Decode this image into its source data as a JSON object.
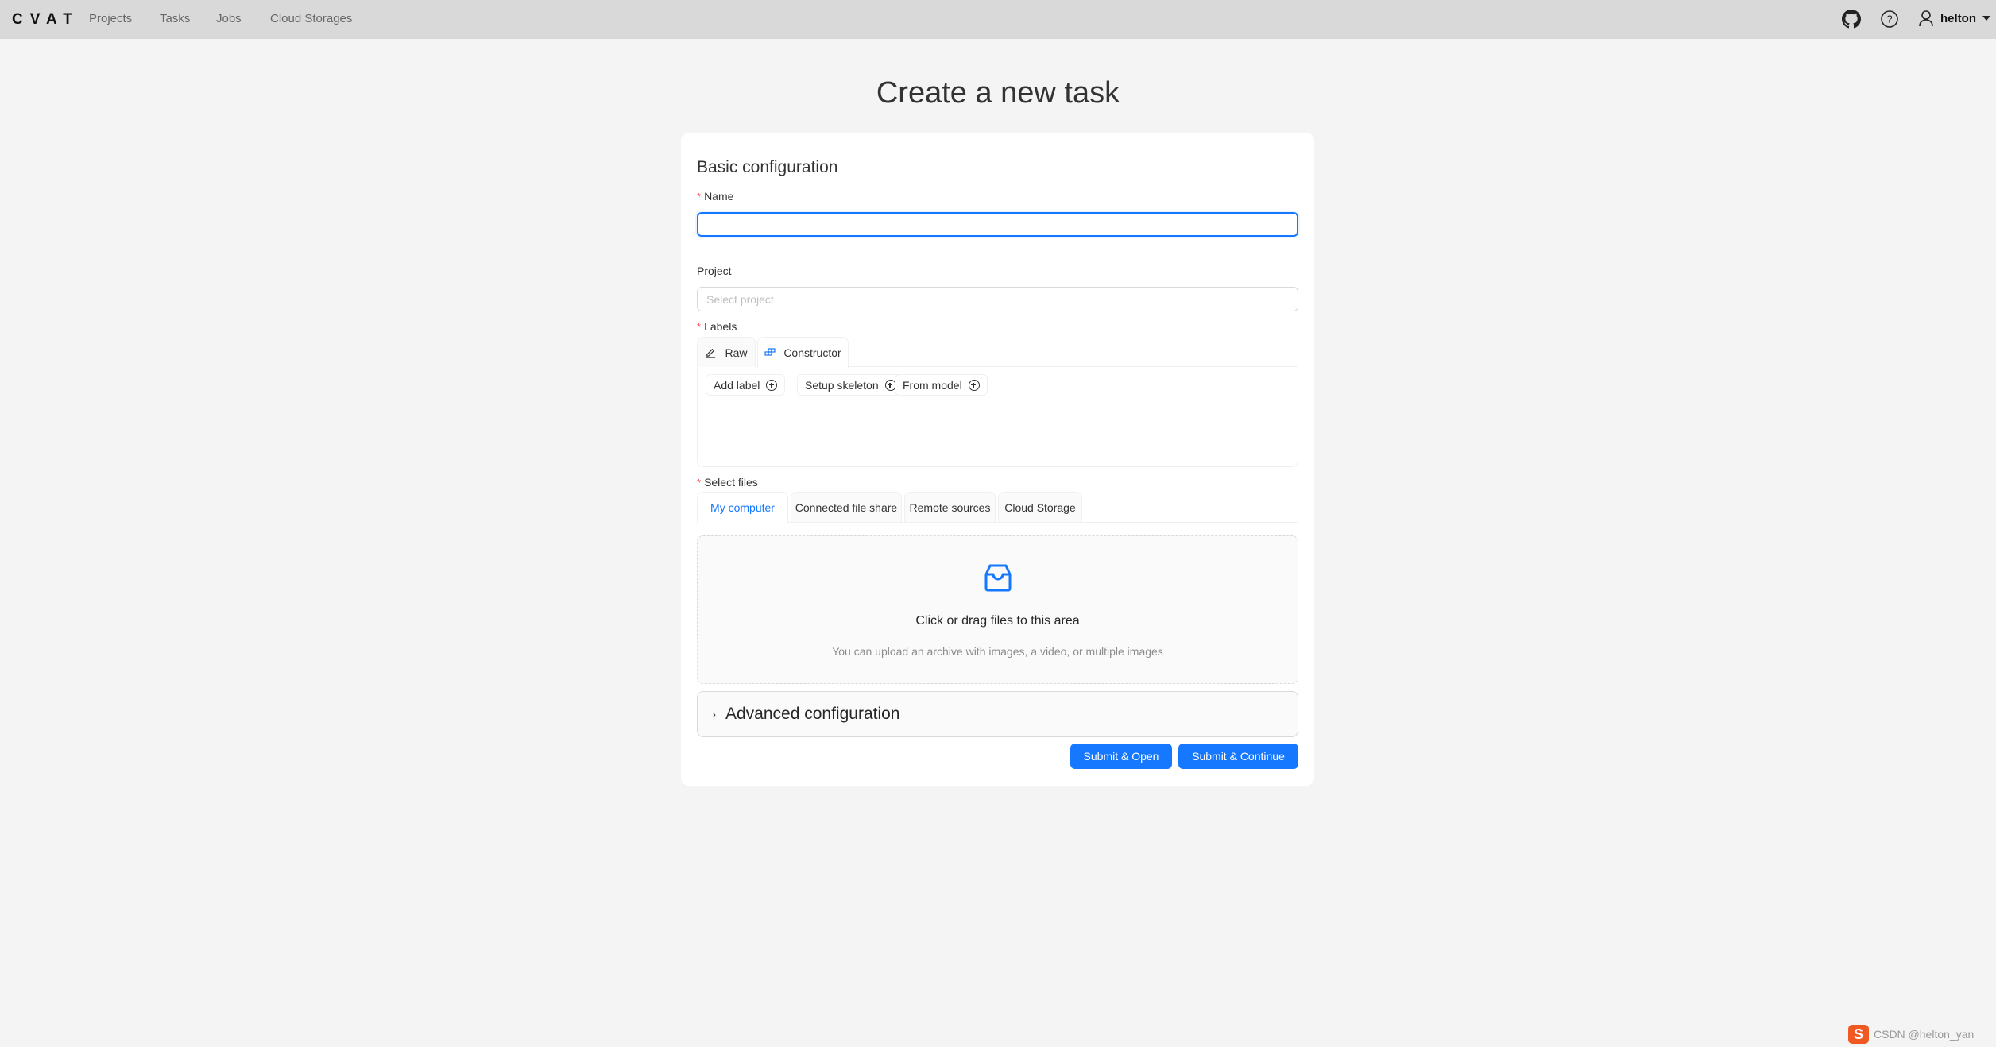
{
  "header": {
    "logo": "CVAT",
    "nav": [
      "Projects",
      "Tasks",
      "Jobs",
      "Cloud Storages"
    ],
    "user": "helton",
    "icons": [
      "github-icon",
      "help-icon",
      "user-icon",
      "caret-down-icon"
    ]
  },
  "page": {
    "title": "Create a new task"
  },
  "form": {
    "section_title": "Basic configuration",
    "name": {
      "label": "Name",
      "required": "*",
      "value": "",
      "placeholder": ""
    },
    "project": {
      "label": "Project",
      "placeholder": "Select project",
      "value": ""
    },
    "labels": {
      "label": "Labels",
      "required": "*",
      "tabs": [
        {
          "label": "Raw",
          "icon": "edit-icon",
          "active": false
        },
        {
          "label": "Constructor",
          "icon": "build-icon",
          "active": true
        }
      ],
      "actions": [
        "Add label",
        "Setup skeleton",
        "From model"
      ]
    },
    "files": {
      "label": "Select files",
      "required": "*",
      "tabs": [
        {
          "label": "My computer",
          "active": true
        },
        {
          "label": "Connected file share",
          "active": false
        },
        {
          "label": "Remote sources",
          "active": false
        },
        {
          "label": "Cloud Storage",
          "active": false
        }
      ],
      "dropzone": {
        "icon": "inbox-icon",
        "text": "Click or drag files to this area",
        "hint": "You can upload an archive with images, a video, or multiple images"
      }
    },
    "advanced": {
      "label": "Advanced configuration",
      "expanded": false
    },
    "buttons": {
      "submit_open": "Submit & Open",
      "submit_continue": "Submit & Continue"
    }
  },
  "colors": {
    "primary": "#1677ff",
    "required": "#ff4d4f",
    "header_bg": "#d9d9d9",
    "page_bg": "#f4f4f4"
  },
  "watermark": {
    "ime": "S",
    "text": "CSDN @helton_yan"
  }
}
